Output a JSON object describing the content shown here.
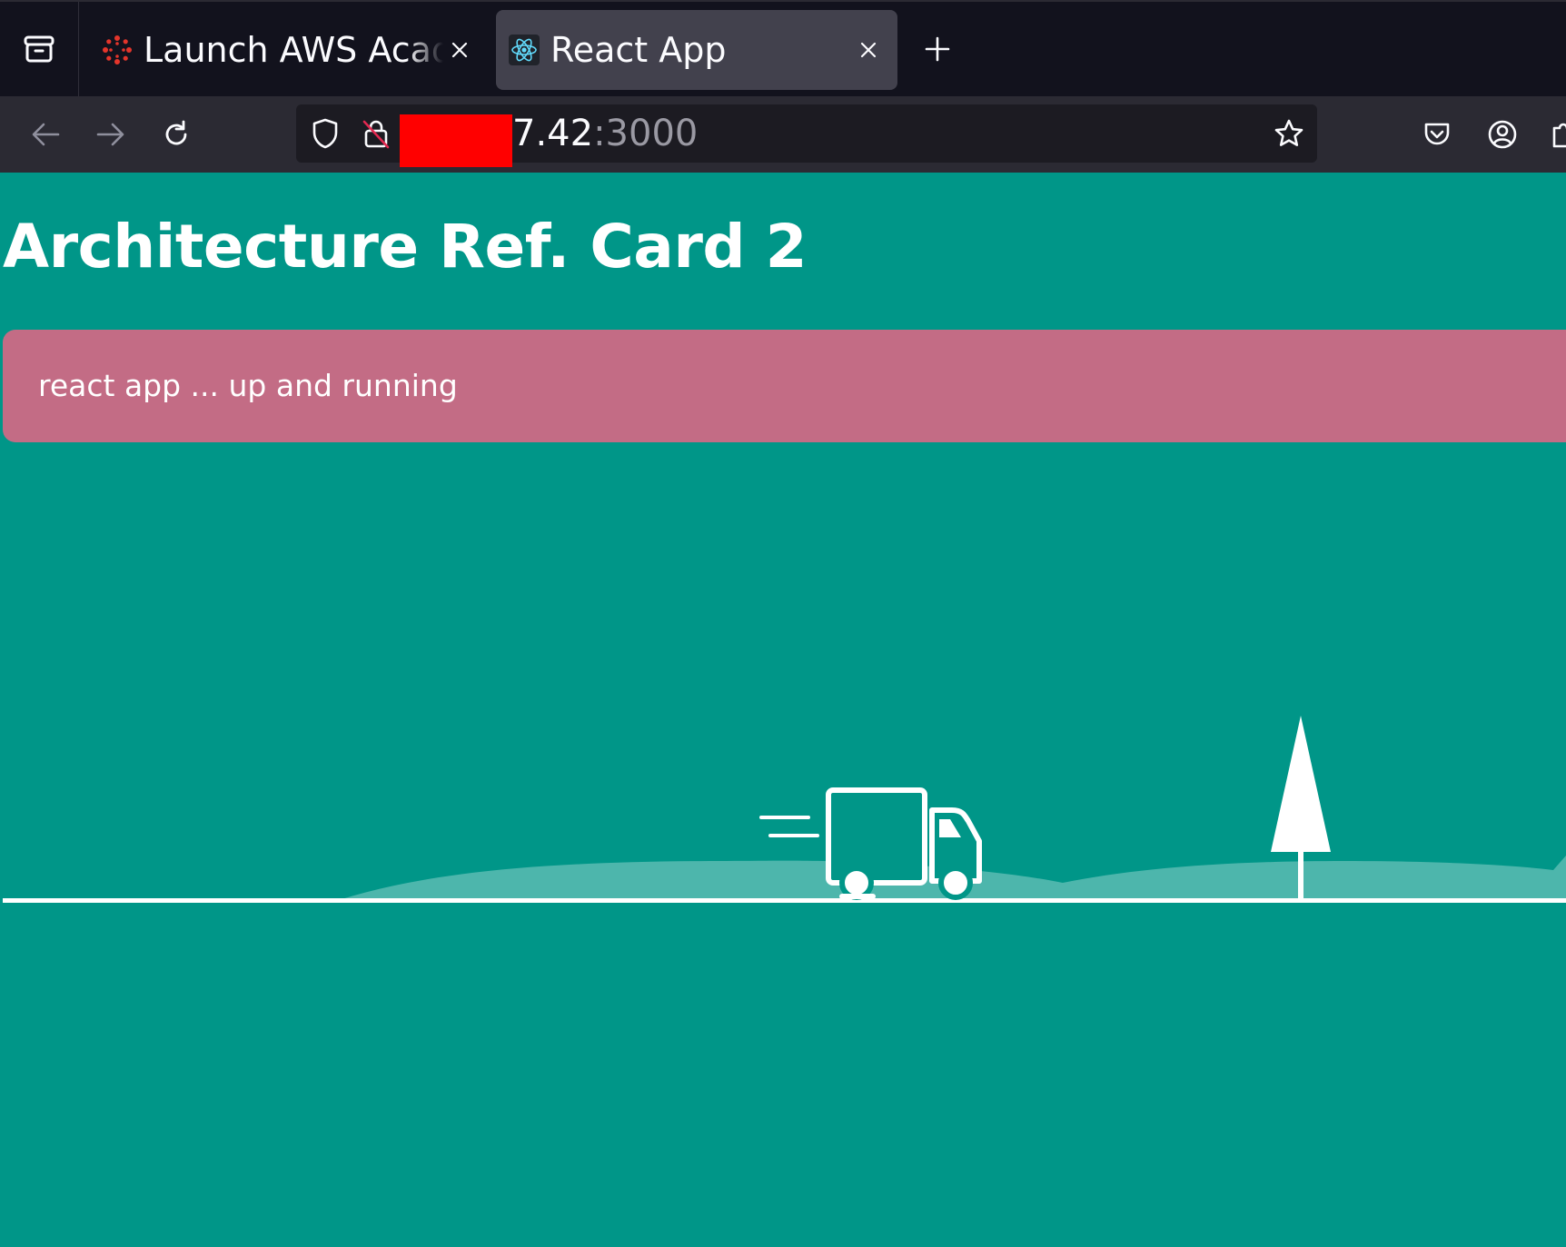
{
  "browser": {
    "tabs": [
      {
        "title": "Launch AWS Academy Learner Lab",
        "icon": "canvas-logo-icon",
        "active": false
      },
      {
        "title": "React App",
        "icon": "react-logo-icon",
        "active": true
      }
    ],
    "new_tab_icon": "plus-icon",
    "address_bar": {
      "url_host": "7.42",
      "url_port": ":3000",
      "redacted": true
    },
    "toolbar_icons": [
      "back-icon",
      "forward-icon",
      "reload-icon",
      "shield-icon",
      "insecure-lock-icon",
      "star-icon",
      "pocket-icon",
      "account-icon",
      "extensions-icon"
    ]
  },
  "page": {
    "title": "Architecture Ref. Card 2",
    "alert_text": "react app ... up and running",
    "colors": {
      "background": "#009688",
      "alert": "#c36c85",
      "hill": "#4db6ac",
      "illustration": "#ffffff"
    },
    "illustration": [
      "truck-icon",
      "tree-icon",
      "hill-shape",
      "ground-line"
    ]
  }
}
